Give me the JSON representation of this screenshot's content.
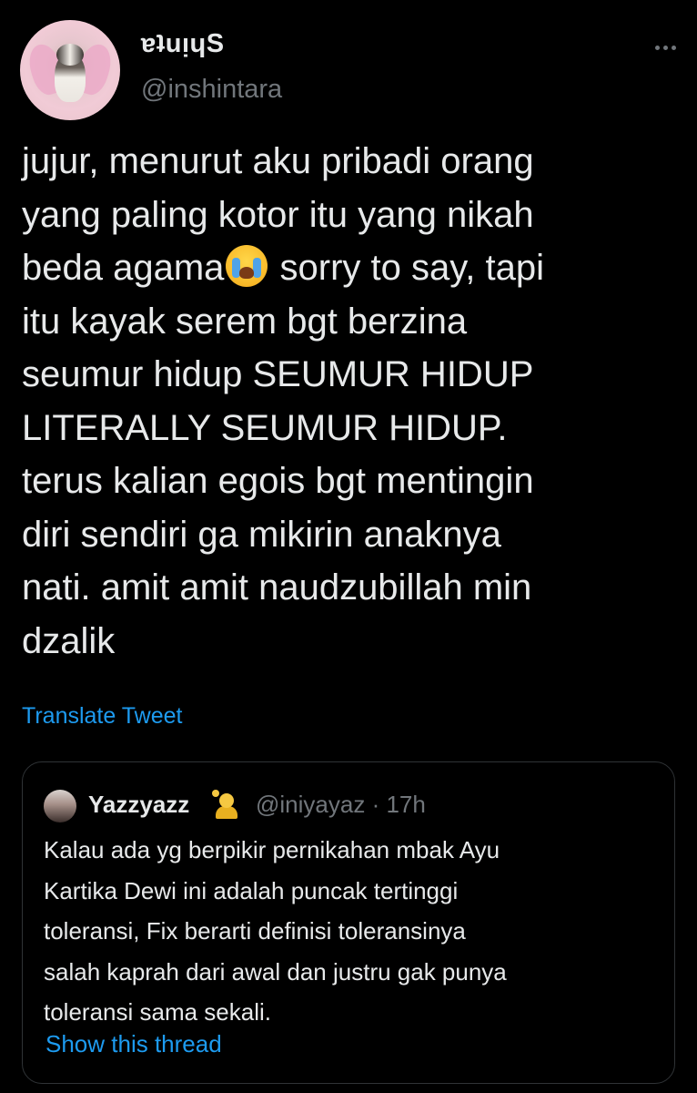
{
  "tweet": {
    "author": {
      "display_name": "ɐʇuᴉɥS",
      "handle": "@inshintara"
    },
    "text_lines": [
      "jujur, menurut aku pribadi orang",
      "yang paling kotor itu yang nikah",
      "beda agama",
      " sorry to say, tapi",
      "itu kayak serem bgt berzina",
      "seumur hidup SEUMUR HIDUP",
      "LITERALLY SEUMUR HIDUP.",
      "terus kalian egois bgt mentingin",
      "diri sendiri ga mikirin anaknya",
      "nati. amit amit naudzubillah min",
      "dzalik"
    ],
    "inline_emoji": "loudly-crying-face-emoji",
    "translate_label": "Translate Tweet"
  },
  "quote": {
    "author": {
      "display_name": "Yazzyazz",
      "name_emoji": "person-gesturing-ok-emoji",
      "handle": "@iniyayaz",
      "separator": "·",
      "time": "17h"
    },
    "text_lines": [
      "Kalau ada yg berpikir pernikahan mbak Ayu",
      "Kartika Dewi ini adalah puncak tertinggi",
      "toleransi, Fix berarti definisi toleransinya",
      "salah kaprah dari awal dan justru gak punya",
      "toleransi sama sekali."
    ],
    "show_thread_label": "Show this thread"
  },
  "colors": {
    "background": "#000000",
    "text_primary": "#e7e9ea",
    "text_secondary": "#71767b",
    "link": "#1d9bf0",
    "border": "#2f3336"
  }
}
